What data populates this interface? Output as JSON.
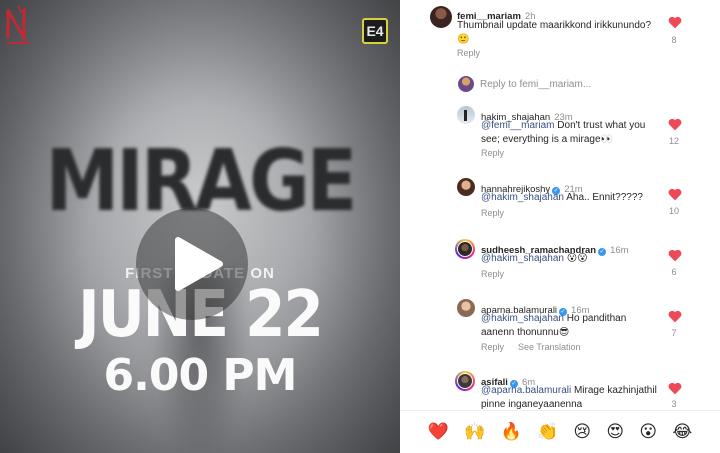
{
  "media": {
    "title": "MIRAGE",
    "subtitle": "FIRST UPDATE ON",
    "date": "JUNE 22",
    "time": "6.00 PM",
    "logo_right": "E4"
  },
  "reply_to": "Reply to femi__mariam...",
  "comments": [
    {
      "user": "femi__mariam",
      "time": "2h",
      "text": "Thumbnail update maarikkond irikkunundo? 🙂",
      "likes": "8",
      "actions": [
        "Reply"
      ]
    },
    {
      "user": "hakim_shajahan",
      "time": "23m",
      "mention": "@femi__mariam",
      "text": " Don't trust what you see; everything is a mirage👀",
      "likes": "12",
      "actions": [
        "Reply"
      ]
    },
    {
      "user": "hannahrejikoshy",
      "time": "21m",
      "mention": "@hakim_shajahan",
      "text": " Aha.. Ennit?????",
      "likes": "10",
      "actions": [
        "Reply"
      ]
    },
    {
      "user": "sudheesh_ramachandran",
      "time": "16m",
      "mention": "@hakim_shajahan",
      "text": " 😮😮",
      "likes": "6",
      "actions": [
        "Reply"
      ]
    },
    {
      "user": "aparna.balamurali",
      "time": "16m",
      "mention": "@hakim_shajahan",
      "text": " Ho pandithan aanenn thonunnu😎",
      "likes": "7",
      "actions": [
        "Reply",
        "See Translation"
      ]
    },
    {
      "user": "asifali",
      "time": "6m",
      "mention": "@aparna.balamurali",
      "text": " Mirage kazhinjathil pinne inganeyaanenna",
      "likes": "3",
      "actions": []
    }
  ],
  "emojis": [
    "❤️",
    "🙌",
    "🔥",
    "👏",
    "😢",
    "😍",
    "😮",
    "😂"
  ],
  "colors": {
    "heart": "#ed4956",
    "mention": "#385185",
    "verified": "#3897f0"
  }
}
